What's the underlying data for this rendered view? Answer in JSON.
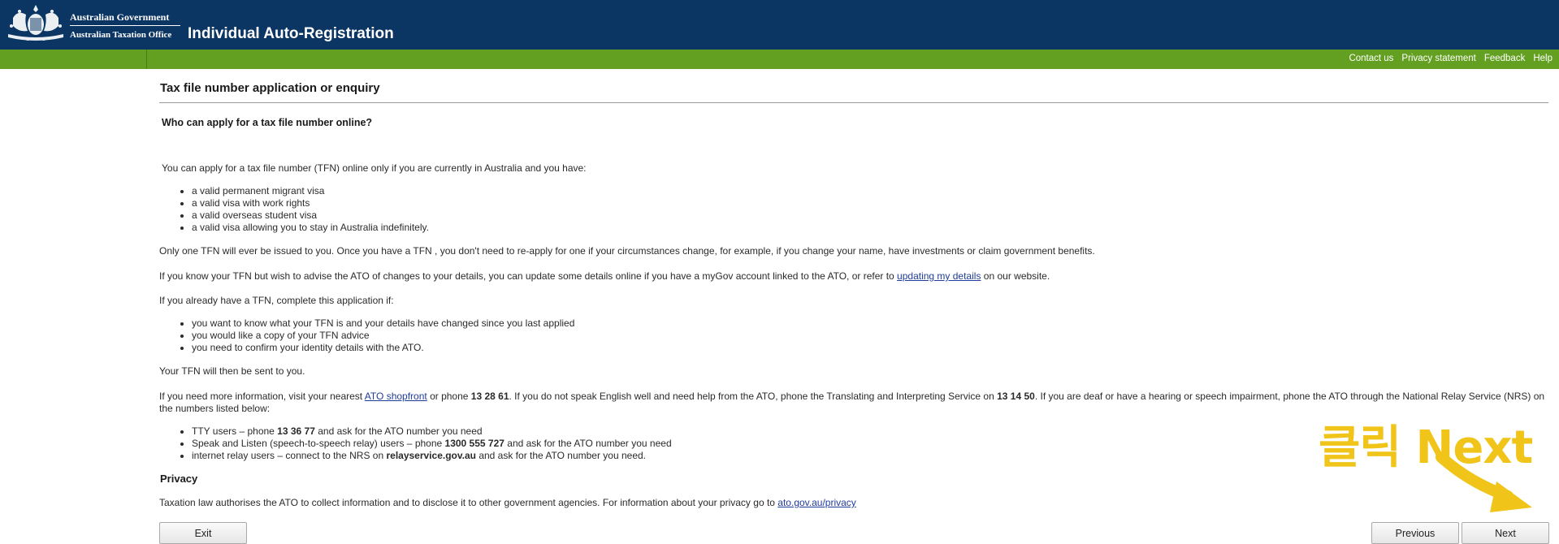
{
  "header": {
    "gov_line1": "Australian Government",
    "gov_line2": "Australian Taxation Office",
    "app_title": "Individual Auto-Registration",
    "bg_color": "#0b3563"
  },
  "toplinks": [
    "Contact us",
    "Privacy statement",
    "Feedback",
    "Help"
  ],
  "greenbar_color": "#63a021",
  "page": {
    "title": "Tax file number application or enquiry",
    "subheading": "Who can apply for a tax file number online?",
    "intro": "You can apply for a tax file number (TFN) online only if you are currently in Australia and you have:",
    "eligibility": [
      "a valid permanent migrant visa",
      "a valid visa with work rights",
      "a valid overseas student visa",
      "a valid visa allowing you to stay in Australia indefinitely."
    ],
    "only_one": "Only one TFN will ever be issued to you. Once you have a TFN , you don't need to re-apply for one if your circumstances change, for example, if you change your name, have investments or claim government benefits.",
    "know_tfn_before": "If you know your TFN but wish to advise the ATO of changes to your details, you can update some details online if you have a myGov account linked to the ATO, or refer to ",
    "know_tfn_link": "updating my details",
    "know_tfn_after": " on our website.",
    "already_have": "If you already have a TFN, complete this application if:",
    "already_list": [
      "you want to know what your TFN is and your details have changed since you last applied",
      "you would like a copy of your TFN advice",
      "you need to confirm your identity details with the ATO."
    ],
    "sent": "Your TFN will then be sent to you.",
    "info_1": "If you need more information, visit your nearest ",
    "info_link": "ATO shopfront",
    "info_2": " or phone ",
    "info_phone1": "13 28 61",
    "info_3": ". If you do not speak English well and need help from the ATO, phone the Translating and Interpreting Service on ",
    "info_phone2": "13 14 50",
    "info_4": ". If you are deaf or have a hearing or speech impairment, phone the ATO through the National Relay Service (NRS) on the numbers listed below:",
    "nrs": {
      "tty_1": "TTY users – phone ",
      "tty_num": "13 36 77",
      "tty_2": " and ask for the ATO number you need",
      "speak_1": "Speak and Listen (speech-to-speech relay) users – phone ",
      "speak_num": "1300 555 727",
      "speak_2": " and ask for the ATO number you need",
      "internet_1": "internet relay users – connect to the NRS on ",
      "internet_site": "relayservice.gov.au",
      "internet_2": " and ask for the ATO number you need."
    },
    "privacy_heading": "Privacy",
    "privacy_text": "Taxation law authorises the ATO to collect information and to disclose it to other government agencies. For information about your privacy go to ",
    "privacy_link": "ato.gov.au/privacy"
  },
  "buttons": {
    "exit": "Exit",
    "previous": "Previous",
    "next": "Next"
  },
  "annotation": {
    "text": "클릭 Next",
    "color": "#f0c419"
  }
}
